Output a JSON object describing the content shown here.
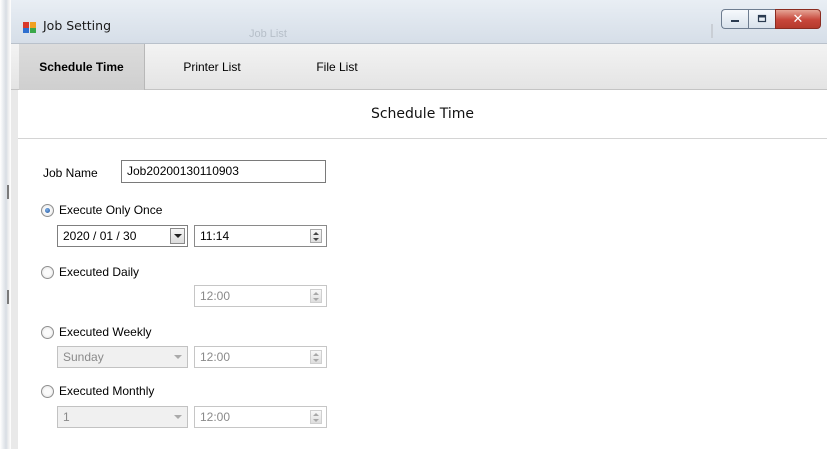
{
  "window": {
    "title": "Job Setting",
    "ghost_title": "Job List"
  },
  "tabs": [
    {
      "label": "Schedule Time",
      "active": true
    },
    {
      "label": "Printer List",
      "active": false
    },
    {
      "label": "File List",
      "active": false
    }
  ],
  "section_title": "Schedule Time",
  "job": {
    "label": "Job Name",
    "value": "Job20200130110903"
  },
  "options": {
    "once": {
      "label": "Execute Only Once",
      "checked": true,
      "date": "2020 / 01 / 30",
      "time": "11:14"
    },
    "daily": {
      "label": "Executed Daily",
      "checked": false,
      "time": "12:00"
    },
    "weekly": {
      "label": "Executed Weekly",
      "checked": false,
      "day": "Sunday",
      "time": "12:00"
    },
    "monthly": {
      "label": "Executed Monthly",
      "checked": false,
      "day": "1",
      "time": "12:00"
    }
  },
  "icons": {
    "app": "job-setting-icon",
    "minimize": "minimize-icon",
    "maximize": "maximize-icon",
    "close": "close-icon"
  },
  "colors": {
    "close_button": "#c7463a",
    "radio_checked": "#1b4f9a"
  }
}
